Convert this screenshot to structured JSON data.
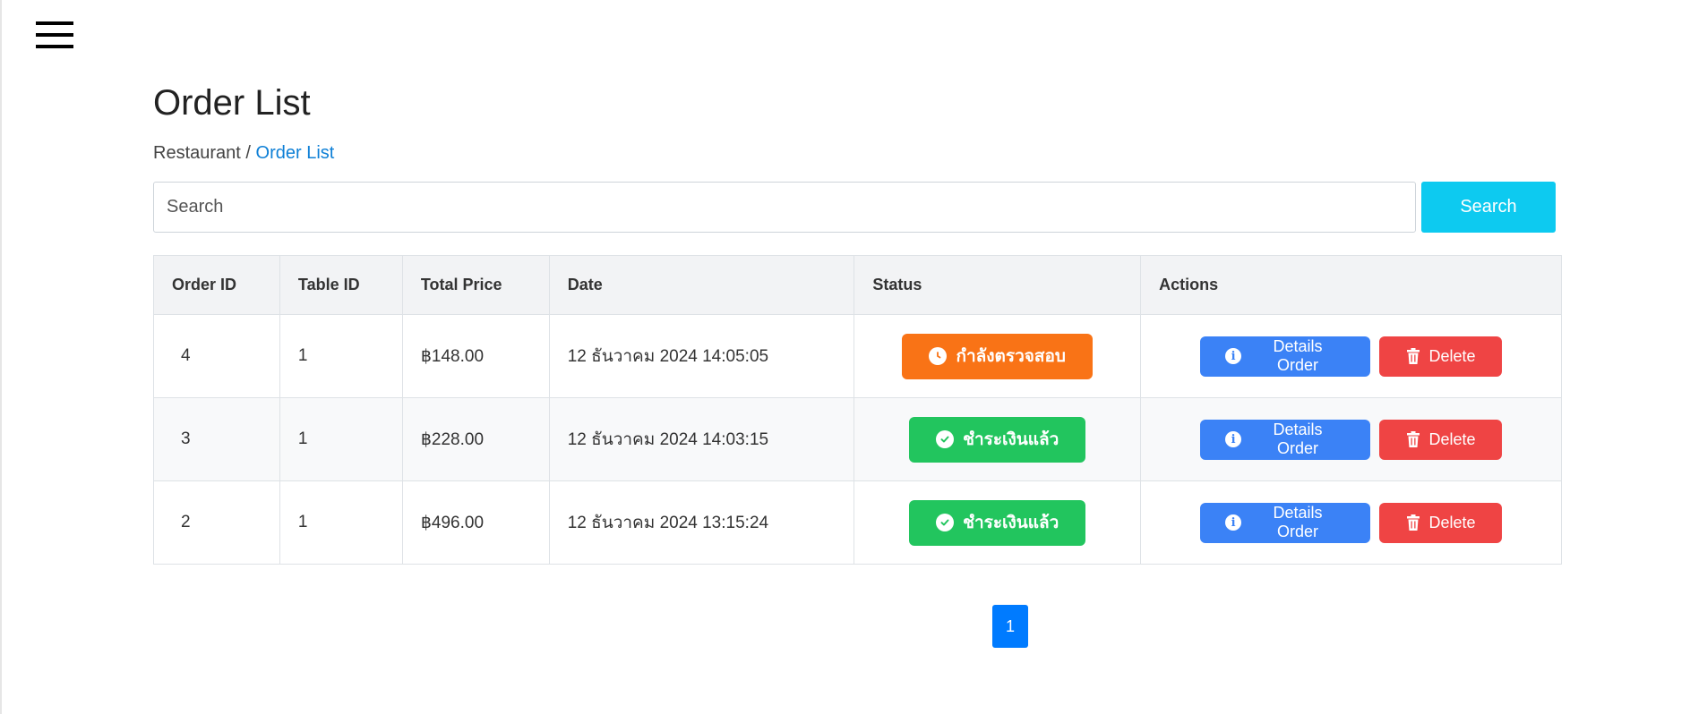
{
  "header": {
    "menu_icon": "hamburger-icon"
  },
  "page": {
    "title": "Order List",
    "breadcrumb": {
      "root": "Restaurant",
      "separator": " / ",
      "current": "Order List"
    }
  },
  "search": {
    "placeholder": "Search",
    "value": "",
    "button_label": "Search"
  },
  "table": {
    "columns": [
      "Order ID",
      "Table ID",
      "Total Price",
      "Date",
      "Status",
      "Actions"
    ],
    "rows": [
      {
        "order_id": "4",
        "table_id": "1",
        "total_price": "฿148.00",
        "date": "12 ธันวาคม 2024 14:05:05",
        "status": "กำลังตรวจสอบ",
        "status_color": "#f97316",
        "status_icon": "clock-icon"
      },
      {
        "order_id": "3",
        "table_id": "1",
        "total_price": "฿228.00",
        "date": "12 ธันวาคม 2024 14:03:15",
        "status": "ชำระเงินแล้ว",
        "status_color": "#22c55e",
        "status_icon": "check-circle-icon"
      },
      {
        "order_id": "2",
        "table_id": "1",
        "total_price": "฿496.00",
        "date": "12 ธันวาคม 2024 13:15:24",
        "status": "ชำระเงินแล้ว",
        "status_color": "#22c55e",
        "status_icon": "check-circle-icon"
      }
    ],
    "actions": {
      "details_label": "Details Order",
      "delete_label": "Delete"
    }
  },
  "pagination": {
    "current_page": "1"
  },
  "colors": {
    "primary": "#007bff",
    "search_button": "#0dcaf0",
    "details_button": "#3b82f6",
    "delete_button": "#ef4444",
    "status_pending": "#f97316",
    "status_paid": "#22c55e"
  }
}
